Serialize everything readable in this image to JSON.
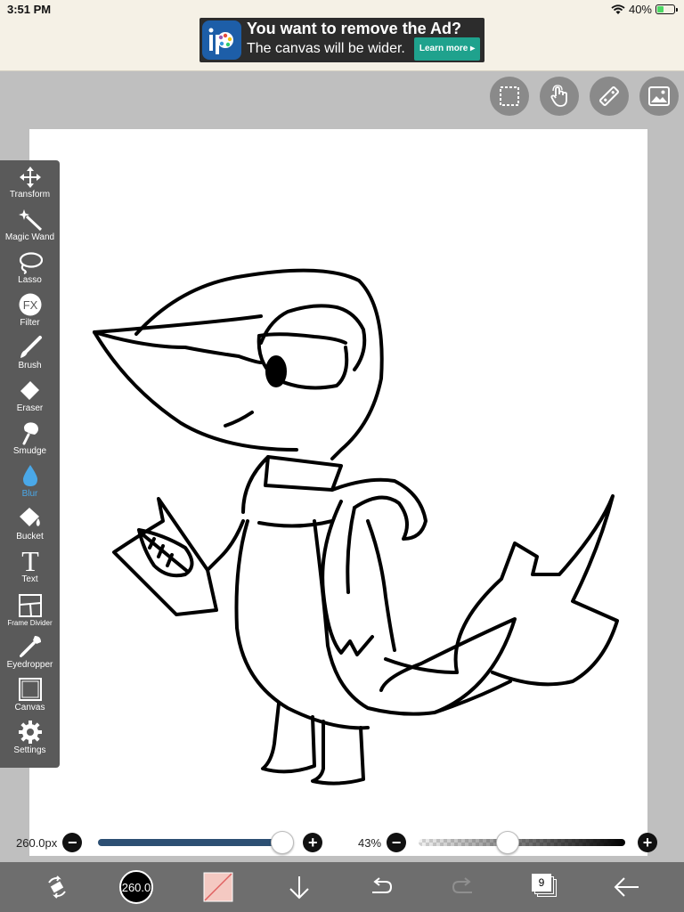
{
  "status": {
    "time": "3:51 PM",
    "battery": "40%",
    "battery_level": 0.4
  },
  "ad": {
    "title": "You want to remove the Ad?",
    "subtitle": "The canvas will be wider.",
    "button": "Learn more ▸"
  },
  "top_tools": [
    "selection-icon",
    "touch-icon",
    "ruler-icon",
    "image-icon"
  ],
  "toolbar": {
    "transform": "Transform",
    "magic_wand": "Magic Wand",
    "lasso": "Lasso",
    "filter": "Filter",
    "filter_icon_text": "FX",
    "brush": "Brush",
    "eraser": "Eraser",
    "smudge": "Smudge",
    "blur": "Blur",
    "bucket": "Bucket",
    "text": "Text",
    "text_icon_text": "T",
    "frame_divider": "Frame Divider",
    "eyedropper": "Eyedropper",
    "canvas": "Canvas",
    "settings": "Settings",
    "active_tool": "Blur"
  },
  "brush_size": {
    "value": "260.0px",
    "level": 0.95
  },
  "opacity": {
    "value": "43%",
    "level": 0.43
  },
  "bottom": {
    "brush_readout": "260.0",
    "layers_count": "9"
  },
  "colors": {
    "toolbar": "#5a5a5a",
    "accent": "#4aa8e8",
    "size_track": "#2c4f73",
    "bottom_bar": "#6e6e6e"
  }
}
